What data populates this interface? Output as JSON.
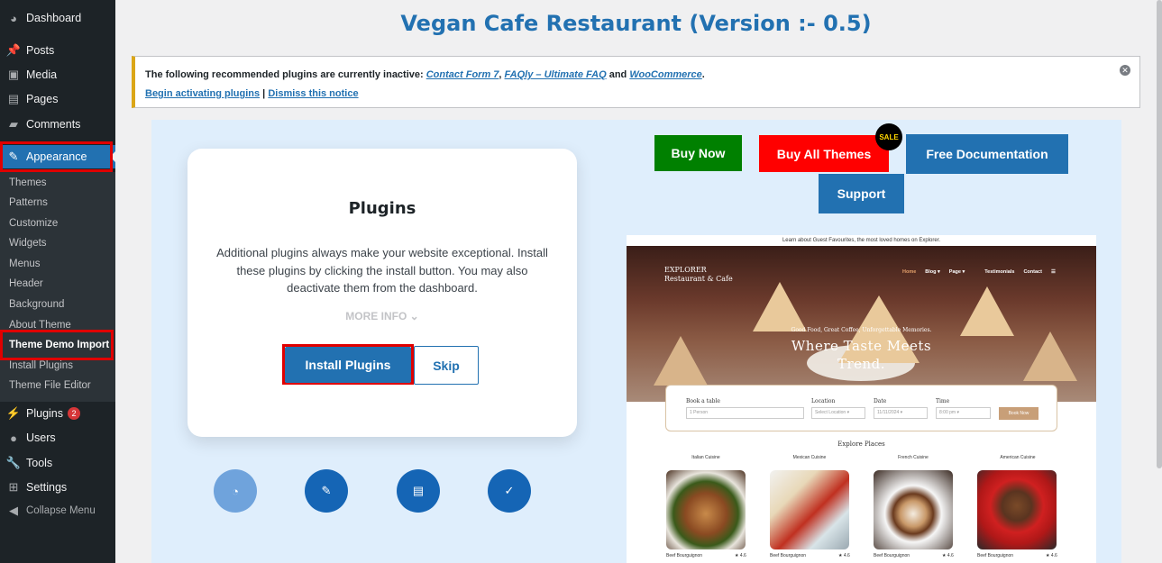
{
  "sidebar": {
    "items": [
      {
        "label": "Dashboard",
        "icon": "dashboard-icon"
      },
      {
        "label": "Posts",
        "icon": "pin-icon"
      },
      {
        "label": "Media",
        "icon": "media-icon"
      },
      {
        "label": "Pages",
        "icon": "pages-icon"
      },
      {
        "label": "Comments",
        "icon": "comment-icon"
      },
      {
        "label": "Appearance",
        "icon": "brush-icon"
      },
      {
        "label": "Plugins",
        "icon": "plug-icon",
        "badge": "2"
      },
      {
        "label": "Users",
        "icon": "user-icon"
      },
      {
        "label": "Tools",
        "icon": "wrench-icon"
      },
      {
        "label": "Settings",
        "icon": "settings-icon"
      },
      {
        "label": "Collapse Menu",
        "icon": "collapse-icon"
      }
    ],
    "submenu": [
      "Themes",
      "Patterns",
      "Customize",
      "Widgets",
      "Menus",
      "Header",
      "Background",
      "About Theme",
      "Theme Demo Import",
      "Install Plugins",
      "Theme File Editor"
    ]
  },
  "header": {
    "title": "Vegan Cafe Restaurant (Version :- 0.5)"
  },
  "notice": {
    "prefix": "The following recommended plugins are currently inactive: ",
    "plugin1": "Contact Form 7",
    "sep1": ", ",
    "plugin2": "FAQly – Ultimate FAQ",
    "sep2": " and ",
    "plugin3": "WooCommerce",
    "suffix": ".",
    "begin": "Begin activating plugins",
    "divider": " | ",
    "dismiss": "Dismiss this notice"
  },
  "card": {
    "title": "Plugins",
    "description": "Additional plugins always make your website exceptional. Install these plugins by clicking the install button. You may also deactivate them from the dashboard.",
    "more_info": "MORE INFO ⌄",
    "install": "Install Plugins",
    "skip": "Skip"
  },
  "steps": [
    {
      "icon": "gauge-icon",
      "glyph": "◔"
    },
    {
      "icon": "plug-icon",
      "glyph": "✎"
    },
    {
      "icon": "layout-icon",
      "glyph": "▤"
    },
    {
      "icon": "check-icon",
      "glyph": "✓"
    }
  ],
  "actions": {
    "buy_now": "Buy Now",
    "buy_all": "Buy All Themes",
    "sale": "SALE",
    "docs": "Free Documentation",
    "support": "Support"
  },
  "colors": {
    "buy_now": "#008000",
    "buy_all": "#ff0000",
    "docs": "#2271b1",
    "support": "#2271b1"
  },
  "preview": {
    "topbar": "Learn about Guest Favourites, the most loved homes on Explorer.",
    "logo_line1": "EXPLORER",
    "logo_line2": "Restaurant & Cafe",
    "nav": [
      "Home",
      "Blog ▾",
      "Page ▾",
      "Testimonials",
      "Contact",
      "☰"
    ],
    "tagline": "Good Food, Great Coffee, Unforgettable Memories.",
    "headline1": "Where Taste Meets",
    "headline2": "Trend.",
    "booking_labels": [
      "Book a table",
      "Location",
      "Date",
      "Time"
    ],
    "booking_values": [
      "1 Person",
      "Select Location ▾",
      "11/11/2024 ▾",
      "8:00 pm ▾"
    ],
    "book_button": "Book Now",
    "explore_title": "Explore Places",
    "categories": [
      "Italian Cuisine",
      "Mexican Cuisine",
      "French Cuisine",
      "American Cuisine"
    ],
    "dishes": [
      "Beef Bourguignon",
      "Beef Bourguignon",
      "Beef Bourguignon",
      "Beef Bourguignon"
    ],
    "ratings": [
      "★ 4.6",
      "★ 4.6",
      "★ 4.6",
      "★ 4.6"
    ]
  }
}
